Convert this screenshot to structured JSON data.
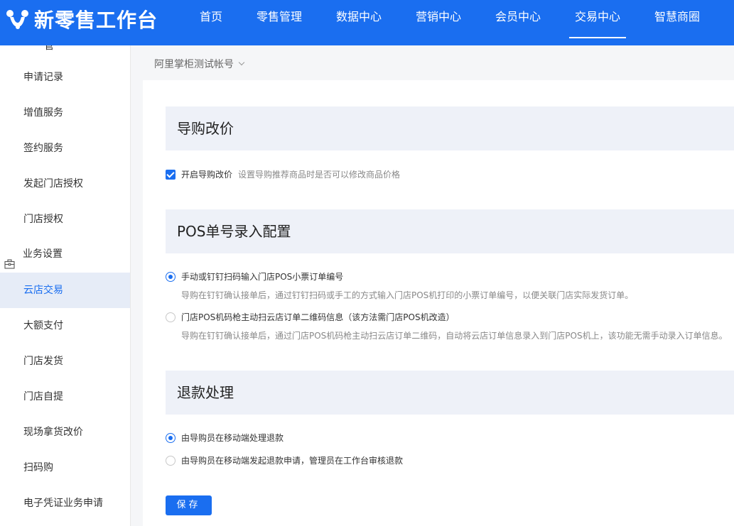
{
  "header": {
    "app_title": "新零售工作台",
    "nav": [
      {
        "label": "首页"
      },
      {
        "label": "零售管理"
      },
      {
        "label": "数据中心"
      },
      {
        "label": "营销中心"
      },
      {
        "label": "会员中心"
      },
      {
        "label": "交易中心"
      },
      {
        "label": "智慧商圈"
      }
    ],
    "active_nav": "交易中心"
  },
  "sidebar": {
    "partial_top": "管",
    "items": [
      {
        "label": "申请记录"
      },
      {
        "label": "增值服务"
      },
      {
        "label": "签约服务"
      },
      {
        "label": "发起门店授权"
      },
      {
        "label": "门店授权"
      },
      {
        "label": "业务设置",
        "icon": "briefcase-icon"
      },
      {
        "label": "云店交易"
      },
      {
        "label": "大额支付"
      },
      {
        "label": "门店发货"
      },
      {
        "label": "门店自提"
      },
      {
        "label": "现场拿货改价"
      },
      {
        "label": "扫码购"
      },
      {
        "label": "电子凭证业务申请"
      }
    ],
    "active_item": "云店交易"
  },
  "account": {
    "name": "阿里掌柜测试帐号"
  },
  "sections": {
    "price_change": {
      "title": "导购改价",
      "checkbox_label": "开启导购改价",
      "checkbox_desc": "设置导购推荐商品时是否可以修改商品价格",
      "checked": true
    },
    "pos_config": {
      "title": "POS单号录入配置",
      "options": [
        {
          "label": "手动或钉钉扫码输入门店POS小票订单编号",
          "desc": "导购在钉钉确认接单后，通过钉钉扫码或手工的方式输入门店POS机打印的小票订单编号，以便关联门店实际发货订单。",
          "selected": true
        },
        {
          "label": "门店POS机码枪主动扫云店订单二维码信息（该方法需门店POS机改造）",
          "desc": "导购在钉钉确认接单后，通过门店POS机码枪主动扫云店订单二维码，自动将云店订单信息录入到门店POS机上，该功能无需手动录入订单信息。",
          "selected": false
        }
      ]
    },
    "refund": {
      "title": "退款处理",
      "options": [
        {
          "label": "由导购员在移动端处理退款",
          "selected": true
        },
        {
          "label": "由导购员在移动端发起退款申请，管理员在工作台审核退款",
          "selected": false
        }
      ]
    }
  },
  "save_label": "保存",
  "colors": {
    "primary": "#1a6ef0",
    "section_bg": "#eef1f8",
    "sidebar_active_bg": "#e6ecf7"
  }
}
